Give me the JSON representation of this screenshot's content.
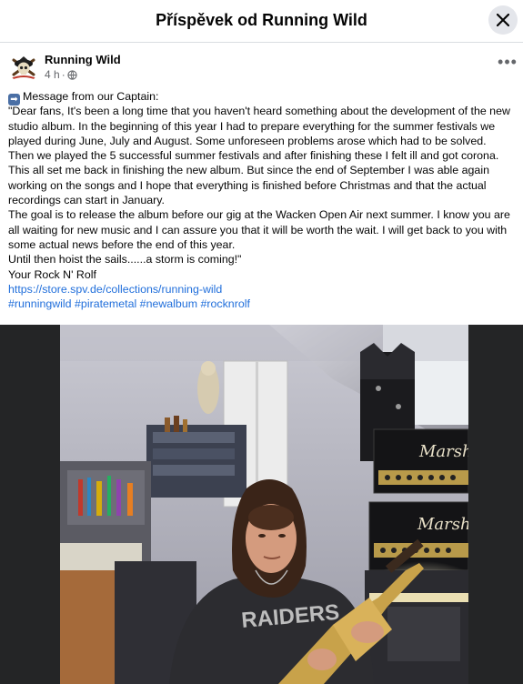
{
  "dialog": {
    "title": "Příspěvek od Running Wild"
  },
  "post": {
    "author": "Running Wild",
    "time": "4 h",
    "visibility_icon": "globe-icon",
    "more_label": "•••",
    "lines": [
      "Message from our Captain:",
      "\"Dear fans, It's been a long time that you haven't heard something about the development of the new",
      "studio album. In the beginning of this year I had to prepare everything for the summer festivals we",
      "played during June, July and August. Some unforeseen problems arose which had to be solved.",
      "Then we played the 5 successful summer festivals and after finishing these I felt ill and got corona.",
      "This all set me back in finishing the new album. But since the end of September I was able again",
      "working on the songs and I hope that everything is finished before Christmas and that the actual",
      "recordings can start in January.",
      "The goal is to release the album before our gig at the Wacken Open Air next summer. I know you are",
      "all waiting for new music and I can assure you that it will be worth the wait. I will get back to you with",
      "some actual news before the end of this year.",
      "Until then hoist the sails......a storm is coming!\"",
      "Your Rock N' Rolf"
    ],
    "link": "https://store.spv.de/collections/running-wild",
    "hashtags": [
      "#runningwild",
      "#piratemetal",
      "#newalbum",
      "#rocknrolf"
    ]
  },
  "photo": {
    "amp_brand": "Marshall",
    "shirt_text": "RAIDERS"
  }
}
